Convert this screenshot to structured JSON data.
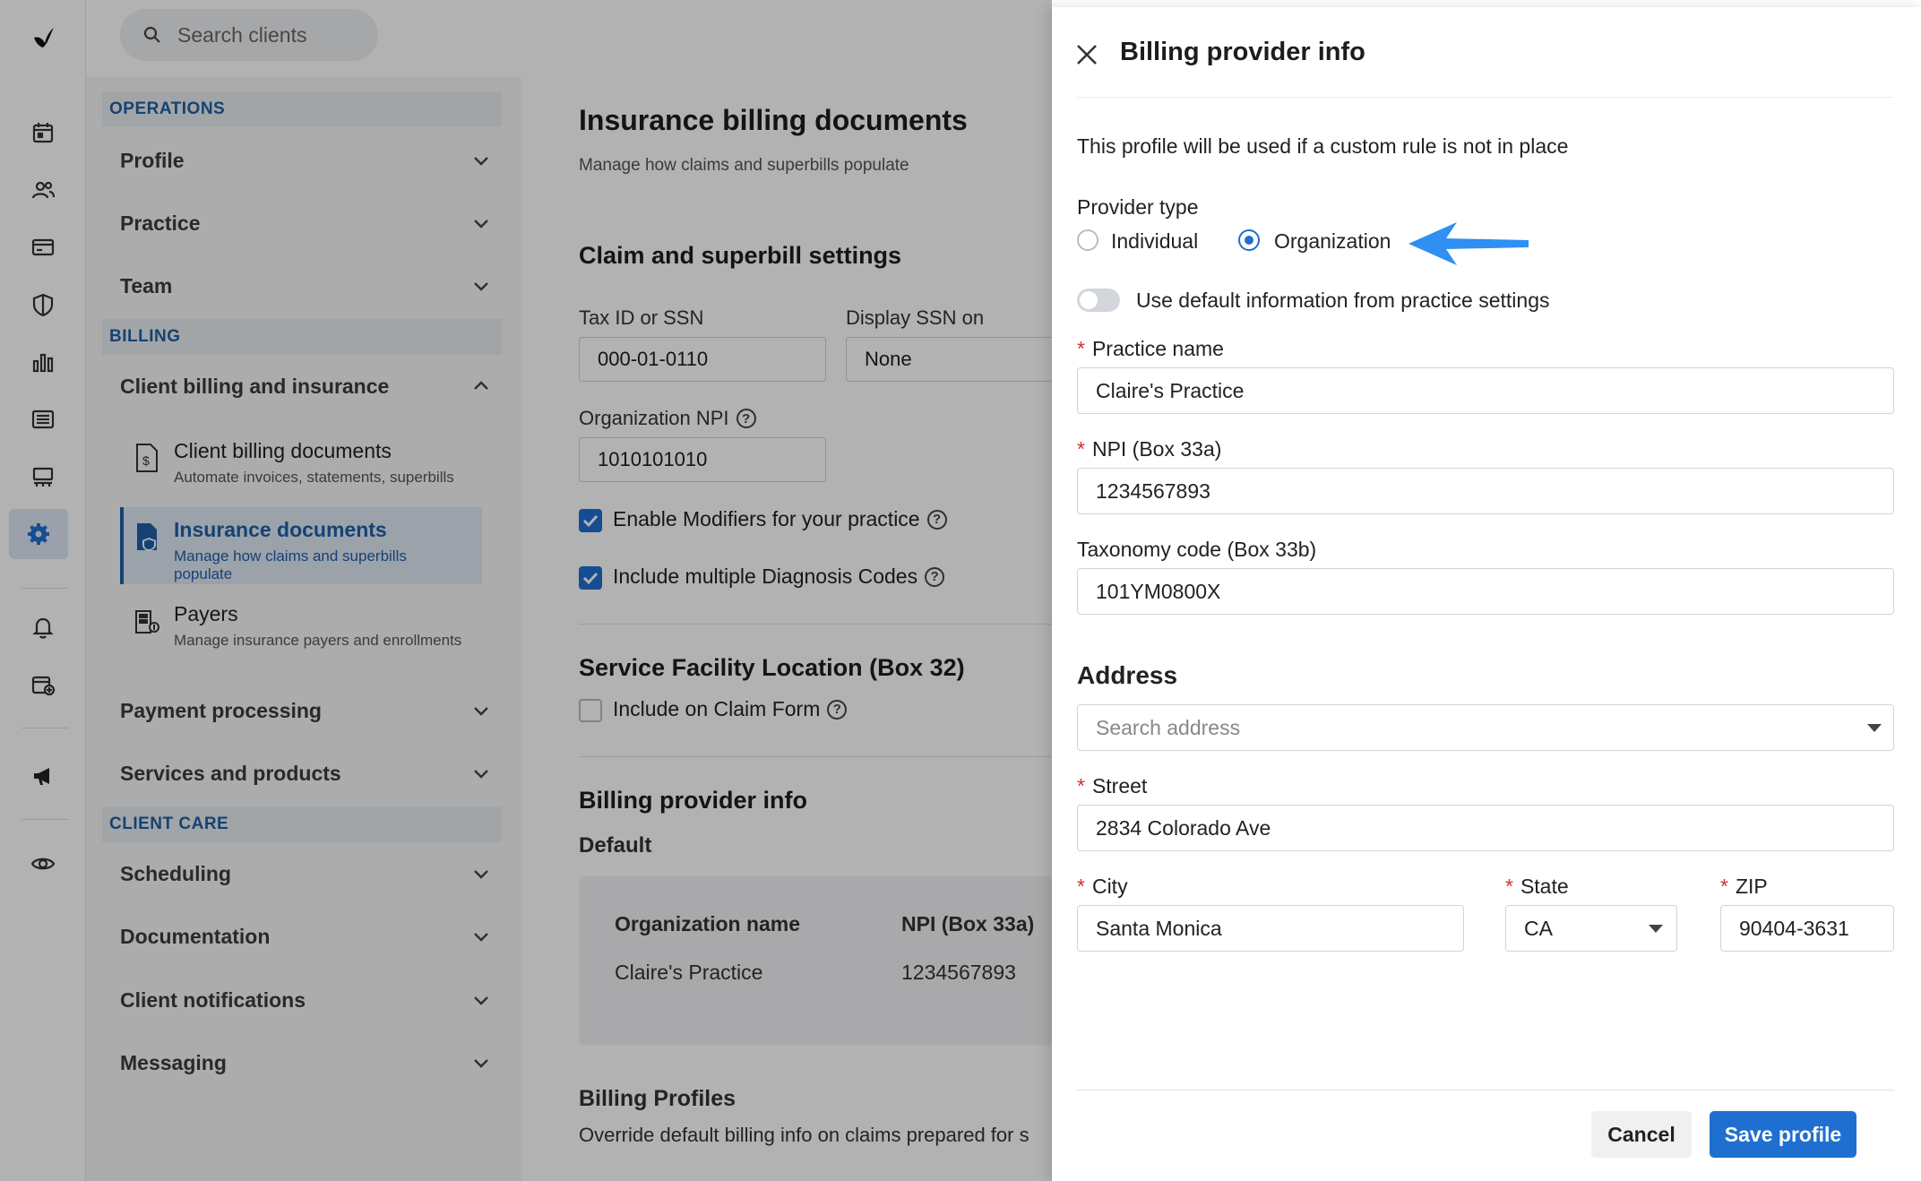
{
  "search": {
    "placeholder": "Search clients"
  },
  "nav": {
    "operations_header": "OPERATIONS",
    "profile": "Profile",
    "practice": "Practice",
    "team": "Team",
    "billing_header": "BILLING",
    "client_billing": "Client billing and insurance",
    "sub_items": [
      {
        "title": "Client billing documents",
        "desc": "Automate invoices, statements, superbills"
      },
      {
        "title": "Insurance documents",
        "desc": "Manage how claims and superbills populate"
      },
      {
        "title": "Payers",
        "desc": "Manage insurance payers and enrollments"
      }
    ],
    "payment_processing": "Payment processing",
    "services_products": "Services and products",
    "client_care_header": "CLIENT CARE",
    "scheduling": "Scheduling",
    "documentation": "Documentation",
    "client_notifications": "Client notifications",
    "messaging": "Messaging"
  },
  "main": {
    "title": "Insurance billing documents",
    "subtitle": "Manage how claims and superbills populate",
    "claim_settings_title": "Claim and superbill settings",
    "tax_label": "Tax ID or SSN",
    "tax_value": "000-01-0110",
    "display_ssn_label": "Display SSN on",
    "display_ssn_value": "None",
    "org_npi_label": "Organization NPI",
    "org_npi_value": "1010101010",
    "modifiers_label": "Enable Modifiers for your practice",
    "diagnosis_label": "Include multiple Diagnosis Codes",
    "service_facility_title": "Service Facility Location (Box 32)",
    "include_claim_label": "Include on Claim Form",
    "billing_provider_title": "Billing provider info",
    "default_label": "Default",
    "col_org_name": "Organization name",
    "col_npi": "NPI (Box 33a)",
    "org_name_value": "Claire's Practice",
    "npi_value": "1234567893",
    "billing_profiles_title": "Billing Profiles",
    "billing_profiles_desc": "Override default billing info on claims prepared for s"
  },
  "drawer": {
    "title": "Billing provider info",
    "intro": "This profile will be used if a custom rule is not in place",
    "provider_type_label": "Provider type",
    "individual_label": "Individual",
    "organization_label": "Organization",
    "use_default_label": "Use default information from practice settings",
    "required_mark": "*",
    "practice_name_label": "Practice name",
    "practice_name_value": "Claire's Practice",
    "npi_label": "NPI (Box 33a)",
    "npi_value": "1234567893",
    "taxonomy_label": "Taxonomy code (Box 33b)",
    "taxonomy_value": "101YM0800X",
    "address_title": "Address",
    "search_address_placeholder": "Search address",
    "street_label": "Street",
    "street_value": "2834 Colorado Ave",
    "city_label": "City",
    "city_value": "Santa Monica",
    "state_label": "State",
    "state_value": "CA",
    "zip_label": "ZIP",
    "zip_value": "90404-3631",
    "cancel_label": "Cancel",
    "save_label": "Save profile"
  },
  "colors": {
    "accent": "#1f6fd1",
    "nav_section": "#1f5fa8",
    "arrow": "#2f8ff2"
  }
}
